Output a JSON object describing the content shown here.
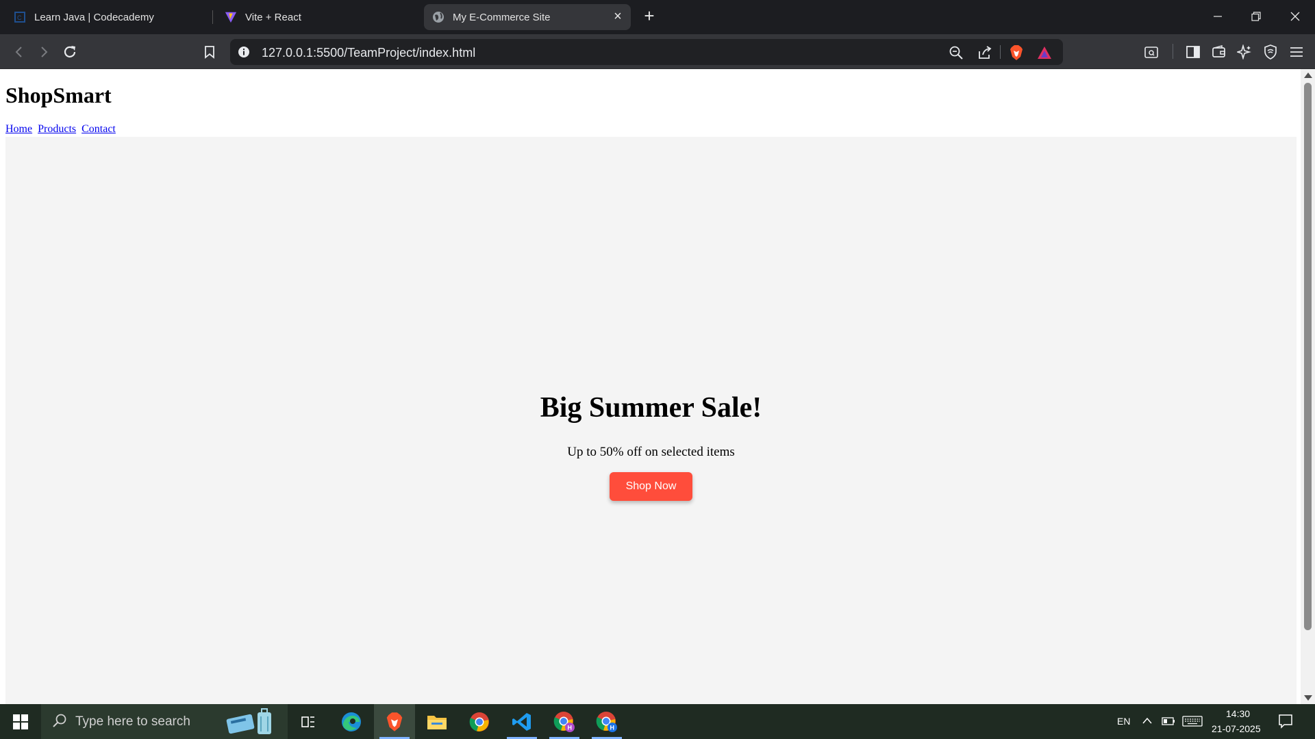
{
  "browser": {
    "tabs": [
      {
        "label": "Learn Java | Codecademy",
        "icon": "codecademy-icon"
      },
      {
        "label": "Vite + React",
        "icon": "vite-icon"
      },
      {
        "label": "My E-Commerce Site",
        "icon": "globe-icon",
        "active": true
      }
    ],
    "url": "127.0.0.1:5500/TeamProject/index.html"
  },
  "page": {
    "site_title": "ShopSmart",
    "nav": [
      "Home",
      "Products",
      "Contact"
    ],
    "hero": {
      "title": "Big Summer Sale!",
      "subtitle": "Up to 50% off on selected items",
      "button": "Shop Now",
      "button_color": "#ff4d3b"
    }
  },
  "taskbar": {
    "search_placeholder": "Type here to search",
    "language": "EN",
    "time": "14:30",
    "date": "21-07-2025"
  }
}
